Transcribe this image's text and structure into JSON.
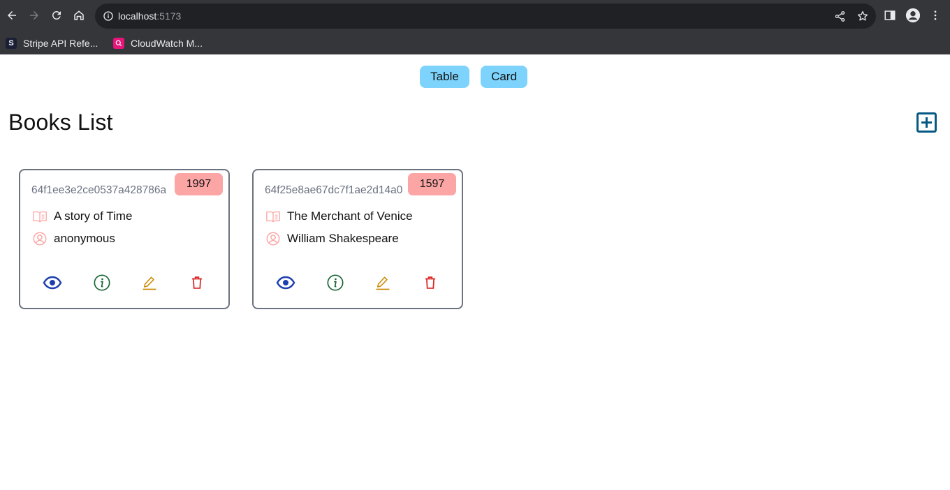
{
  "browser": {
    "url_host": "localhost",
    "url_port": ":5173",
    "bookmarks": [
      {
        "label": "Stripe API Refe...",
        "icon": "stripe-favicon",
        "favicon_letter": "S",
        "color": "#1a1f36"
      },
      {
        "label": "CloudWatch M...",
        "icon": "cloudwatch-favicon",
        "favicon_letter": "",
        "color": "#e7157b"
      }
    ]
  },
  "view_toggle": {
    "table_label": "Table",
    "card_label": "Card"
  },
  "header": {
    "title": "Books List",
    "add_icon": "plus-square-icon"
  },
  "books": [
    {
      "id": "64f1ee3e2ce0537a428786a",
      "publish_year": "1997",
      "title": "A story of Time",
      "author": "anonymous"
    },
    {
      "id": "64f25e8ae67dc7f1ae2d14a0",
      "publish_year": "1597",
      "title": "The Merchant of Venice",
      "author": "William Shakespeare"
    }
  ],
  "colors": {
    "toggle_bg": "#7dd3fc",
    "badge_bg": "#fca5a5",
    "icon_accent": "#fca5a5",
    "view_icon": "#1e40af",
    "info_icon": "#166534",
    "edit_icon": "#ca8a04",
    "delete_icon": "#dc2626",
    "add_icon": "#075985"
  }
}
